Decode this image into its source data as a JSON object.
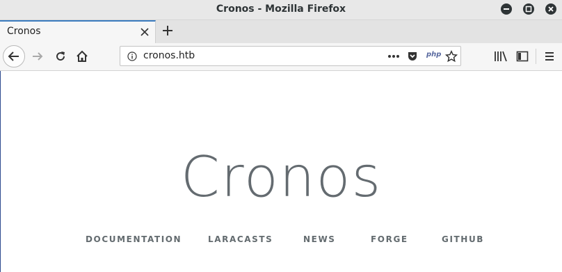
{
  "window": {
    "title": "Cronos - Mozilla Firefox"
  },
  "tab": {
    "label": "Cronos"
  },
  "address_bar": {
    "url": "cronos.htb",
    "php_badge": "php"
  },
  "page": {
    "heading": "Cronos",
    "links": [
      "DOCUMENTATION",
      "LARACASTS",
      "NEWS",
      "FORGE",
      "GITHUB"
    ]
  }
}
